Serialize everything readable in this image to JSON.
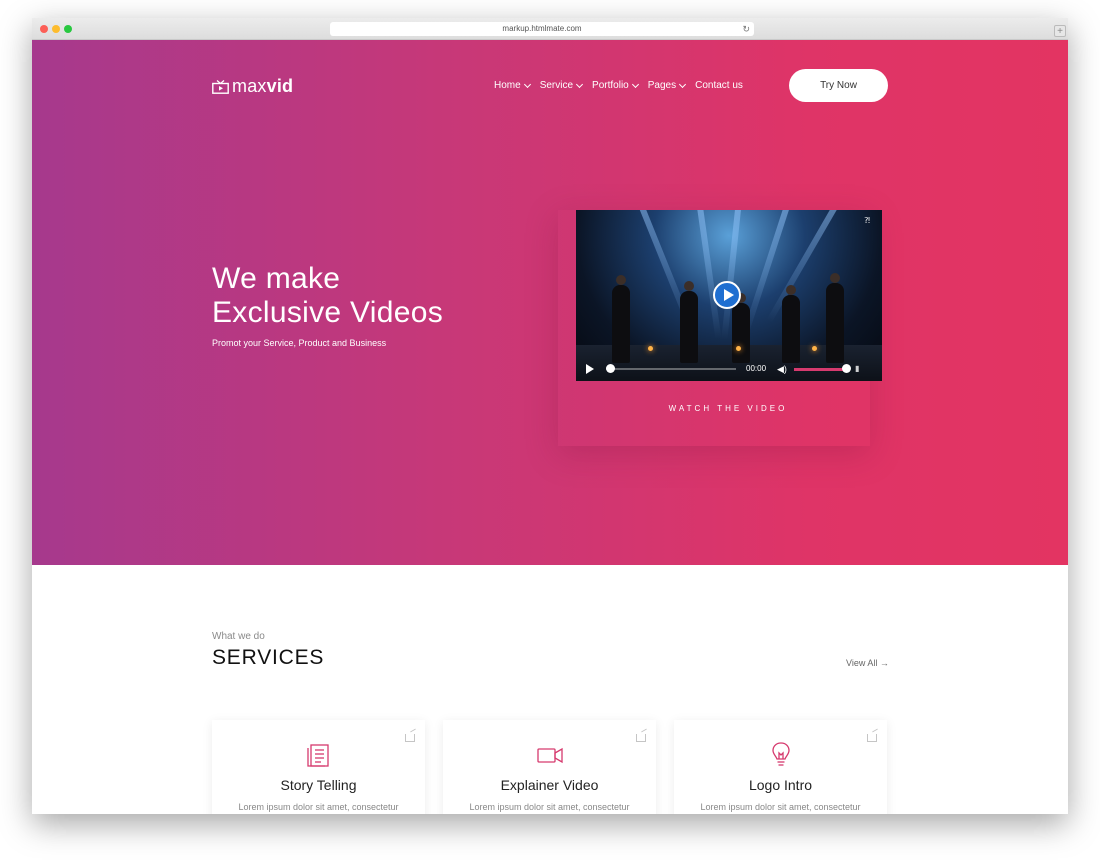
{
  "browser": {
    "url": "markup.htmlmate.com"
  },
  "logo": {
    "light": "max",
    "bold": "vid"
  },
  "nav": {
    "items": [
      {
        "label": "Home",
        "has_dropdown": true
      },
      {
        "label": "Service",
        "has_dropdown": true
      },
      {
        "label": "Portfolio",
        "has_dropdown": true
      },
      {
        "label": "Pages",
        "has_dropdown": true
      },
      {
        "label": "Contact us",
        "has_dropdown": false
      }
    ],
    "cta": "Try Now"
  },
  "hero": {
    "title_line1": "We make",
    "title_line2": "Exclusive Videos",
    "subtitle": "Promot your Service, Product and Business",
    "video_time": "00:00",
    "watch_label": "WATCH THE VIDEO"
  },
  "services": {
    "kicker": "What we do",
    "title": "SERVICES",
    "view_all": "View All",
    "cards": [
      {
        "title": "Story Telling",
        "text": "Lorem ipsum dolor sit amet, consectetur",
        "icon": "document-icon"
      },
      {
        "title": "Explainer Video",
        "text": "Lorem ipsum dolor sit amet, consectetur",
        "icon": "video-camera-icon"
      },
      {
        "title": "Logo Intro",
        "text": "Lorem ipsum dolor sit amet, consectetur",
        "icon": "lightbulb-icon"
      }
    ]
  },
  "colors": {
    "gradient_start": "#a6398d",
    "gradient_end": "#e33462",
    "accent": "#d63a6e"
  }
}
